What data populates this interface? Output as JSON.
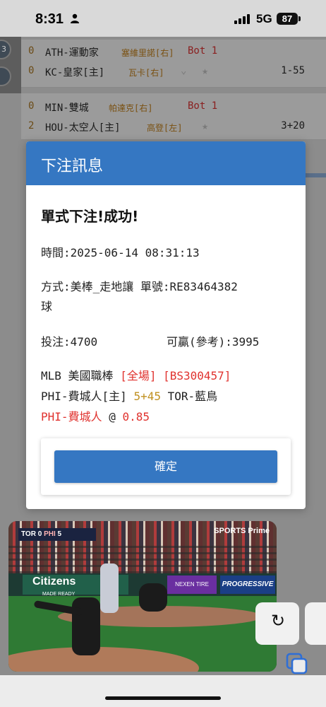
{
  "status_bar": {
    "time": "8:31",
    "network": "5G",
    "battery": "87"
  },
  "left_strip": {
    "badge": "3"
  },
  "matches": [
    {
      "rows": [
        {
          "score": "0",
          "team": "ATH-運動家",
          "pitcher": "塞維里諾[右]",
          "inning": "Bot 1",
          "line": ""
        },
        {
          "score": "0",
          "team": "KC-皇家[主]",
          "pitcher": "瓦卡[右]",
          "inning": "",
          "line": "1-55"
        }
      ]
    },
    {
      "rows": [
        {
          "score": "0",
          "team": "MIN-雙城",
          "pitcher": "帕達克[右]",
          "inning": "Bot 1",
          "line": ""
        },
        {
          "score": "2",
          "team": "HOU-太空人[主]",
          "pitcher": "高登[左]",
          "inning": "",
          "line": "3+20"
        }
      ]
    }
  ],
  "modal": {
    "title": "下注訊息",
    "success": "單式下注!成功!",
    "time": "時間:2025-06-14 08:31:13",
    "method_line1": "方式:美棒_走地讓  單號:RE83464382",
    "method_line2": "球",
    "stake": "投注:4700",
    "win": "可贏(參考):3995",
    "league": "MLB 美國職棒",
    "period": "[全場]",
    "bet_code": "[BS300457]",
    "home_team": "PHI-費城人[主]",
    "handicap": "5+45",
    "away_team": "TOR-藍鳥",
    "pick_team": "PHI-費城人",
    "at": "@",
    "odds": "0.85",
    "confirm": "確定"
  },
  "video": {
    "scorebug_away": "TOR",
    "scorebug_away_score": "0",
    "scorebug_home": "PHI",
    "scorebug_home_score": "5",
    "network": "SPORTS Prime",
    "ad_citizens": "Citizens",
    "ad_citizens_sub": "MADE READY",
    "ad_nexen": "NEXEN TIRE",
    "ad_progressive": "PROGRESSIVE"
  },
  "colors": {
    "accent": "#3577c2",
    "highlight_red": "#e0322e",
    "handicap_gold": "#c09020"
  },
  "icons": [
    "person-icon",
    "signal-icon",
    "star-icon",
    "chevron-down-icon",
    "rotate-arrow-icon",
    "copy-icon"
  ]
}
